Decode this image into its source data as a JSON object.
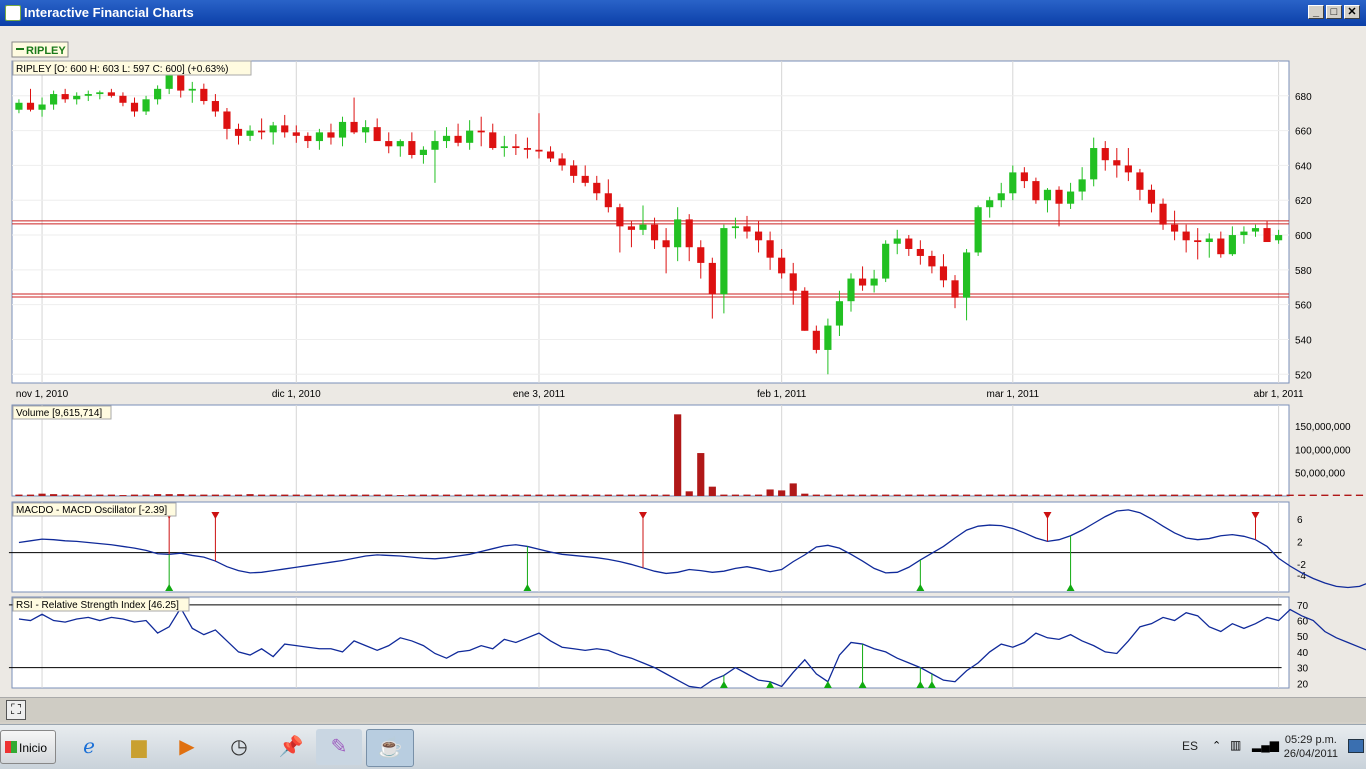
{
  "window": {
    "title": "Interactive Financial Charts",
    "min": "_",
    "max": "□",
    "close": "✕"
  },
  "legend": {
    "symbol": "RIPLEY"
  },
  "price_panel": {
    "label": "RIPLEY [O: 600  H: 603  L: 597  C: 600] (+0.63%)"
  },
  "volume_panel": {
    "label": "Volume [9,615,714]"
  },
  "macd_panel": {
    "label": "MACDO - MACD Oscillator [-2.39]"
  },
  "rsi_panel": {
    "label": "RSI - Relative Strength Index [46.25]"
  },
  "colors": {
    "up": "#22c022",
    "down": "#dd1111",
    "line": "#102a9a",
    "hline": "#cc2222",
    "grid": "#d6d6d6"
  },
  "taskbar": {
    "start": "Inicio",
    "lang": "ES",
    "time": "05:29 p.m.",
    "date": "26/04/2011"
  },
  "chart_data": [
    {
      "type": "candlestick",
      "name": "RIPLEY",
      "ylim": [
        515,
        700
      ],
      "yticks": [
        520,
        540,
        560,
        580,
        600,
        620,
        640,
        660,
        680
      ],
      "xlabels": [
        "nov 1, 2010",
        "dic 1, 2010",
        "ene 3, 2011",
        "feb 1, 2011",
        "mar 1, 2011",
        "abr 1, 2011"
      ],
      "xlabel_index": [
        2,
        24,
        45,
        66,
        86,
        109
      ],
      "hlines": [
        607,
        565
      ],
      "candles": [
        [
          672,
          678,
          670,
          676
        ],
        [
          676,
          684,
          671,
          672
        ],
        [
          672,
          679,
          668,
          675
        ],
        [
          675,
          683,
          672,
          681
        ],
        [
          681,
          684,
          676,
          678
        ],
        [
          678,
          682,
          675,
          680
        ],
        [
          680,
          683,
          677,
          681
        ],
        [
          681,
          683,
          678,
          682
        ],
        [
          682,
          684,
          679,
          680
        ],
        [
          680,
          682,
          674,
          676
        ],
        [
          676,
          679,
          668,
          671
        ],
        [
          671,
          680,
          669,
          678
        ],
        [
          678,
          686,
          675,
          684
        ],
        [
          684,
          700,
          681,
          697
        ],
        [
          697,
          699,
          679,
          683
        ],
        [
          683,
          688,
          676,
          684
        ],
        [
          684,
          687,
          675,
          677
        ],
        [
          677,
          681,
          668,
          671
        ],
        [
          671,
          673,
          655,
          661
        ],
        [
          661,
          664,
          652,
          657
        ],
        [
          657,
          663,
          654,
          660
        ],
        [
          660,
          667,
          655,
          659
        ],
        [
          659,
          665,
          652,
          663
        ],
        [
          663,
          669,
          656,
          659
        ],
        [
          659,
          663,
          653,
          657
        ],
        [
          657,
          659,
          650,
          654
        ],
        [
          654,
          661,
          649,
          659
        ],
        [
          659,
          664,
          652,
          656
        ],
        [
          656,
          668,
          651,
          665
        ],
        [
          665,
          679,
          658,
          659
        ],
        [
          659,
          666,
          653,
          662
        ],
        [
          662,
          667,
          655,
          654
        ],
        [
          654,
          659,
          647,
          651
        ],
        [
          651,
          655,
          645,
          654
        ],
        [
          654,
          659,
          644,
          646
        ],
        [
          646,
          651,
          641,
          649
        ],
        [
          649,
          660,
          630,
          654
        ],
        [
          654,
          662,
          650,
          657
        ],
        [
          657,
          664,
          651,
          653
        ],
        [
          653,
          666,
          649,
          660
        ],
        [
          660,
          668,
          651,
          659
        ],
        [
          659,
          664,
          649,
          650
        ],
        [
          650,
          657,
          645,
          651
        ],
        [
          651,
          658,
          646,
          650
        ],
        [
          650,
          656,
          644,
          649
        ],
        [
          649,
          670,
          644,
          648
        ],
        [
          648,
          651,
          642,
          644
        ],
        [
          644,
          647,
          637,
          640
        ],
        [
          640,
          643,
          630,
          634
        ],
        [
          634,
          640,
          628,
          630
        ],
        [
          630,
          634,
          620,
          624
        ],
        [
          624,
          632,
          613,
          616
        ],
        [
          616,
          618,
          590,
          605
        ],
        [
          605,
          608,
          593,
          603
        ],
        [
          603,
          617,
          600,
          606
        ],
        [
          606,
          610,
          592,
          597
        ],
        [
          597,
          604,
          578,
          593
        ],
        [
          593,
          616,
          585,
          609
        ],
        [
          609,
          612,
          585,
          593
        ],
        [
          593,
          597,
          575,
          584
        ],
        [
          584,
          587,
          552,
          566
        ],
        [
          566,
          606,
          555,
          604
        ],
        [
          604,
          610,
          598,
          605
        ],
        [
          605,
          611,
          598,
          602
        ],
        [
          602,
          608,
          590,
          597
        ],
        [
          597,
          602,
          580,
          587
        ],
        [
          587,
          592,
          575,
          578
        ],
        [
          578,
          584,
          560,
          568
        ],
        [
          568,
          570,
          545,
          545
        ],
        [
          545,
          548,
          532,
          534
        ],
        [
          534,
          552,
          520,
          548
        ],
        [
          548,
          568,
          542,
          562
        ],
        [
          562,
          578,
          556,
          575
        ],
        [
          575,
          582,
          568,
          571
        ],
        [
          571,
          580,
          567,
          575
        ],
        [
          575,
          597,
          573,
          595
        ],
        [
          595,
          603,
          589,
          598
        ],
        [
          598,
          600,
          588,
          592
        ],
        [
          592,
          597,
          583,
          588
        ],
        [
          588,
          591,
          578,
          582
        ],
        [
          582,
          589,
          570,
          574
        ],
        [
          574,
          577,
          558,
          564
        ],
        [
          564,
          592,
          551,
          590
        ],
        [
          590,
          617,
          588,
          616
        ],
        [
          616,
          622,
          610,
          620
        ],
        [
          620,
          630,
          616,
          624
        ],
        [
          624,
          640,
          620,
          636
        ],
        [
          636,
          639,
          627,
          631
        ],
        [
          631,
          633,
          618,
          620
        ],
        [
          620,
          627,
          613,
          626
        ],
        [
          626,
          628,
          605,
          618
        ],
        [
          618,
          630,
          615,
          625
        ],
        [
          625,
          639,
          620,
          632
        ],
        [
          632,
          656,
          628,
          650
        ],
        [
          650,
          654,
          637,
          643
        ],
        [
          643,
          650,
          633,
          640
        ],
        [
          640,
          650,
          631,
          636
        ],
        [
          636,
          638,
          620,
          626
        ],
        [
          626,
          629,
          613,
          618
        ],
        [
          618,
          621,
          603,
          606
        ],
        [
          606,
          614,
          597,
          602
        ],
        [
          602,
          606,
          590,
          597
        ],
        [
          597,
          604,
          586,
          596
        ],
        [
          596,
          601,
          587,
          598
        ],
        [
          598,
          602,
          587,
          589
        ],
        [
          589,
          605,
          588,
          600
        ],
        [
          600,
          605,
          595,
          602
        ],
        [
          602,
          606,
          599,
          604
        ],
        [
          604,
          608,
          596,
          596
        ],
        [
          597,
          603,
          595,
          600
        ]
      ]
    },
    {
      "type": "bar",
      "name": "Volume",
      "ylim": [
        0,
        195000000
      ],
      "yticks": [
        50000000,
        100000000,
        150000000
      ],
      "ytick_labels": [
        "50,000,000",
        "100,000,000",
        "150,000,000"
      ],
      "values": [
        3,
        3,
        5,
        4,
        3,
        3,
        3,
        3,
        3,
        2,
        3,
        3,
        4,
        4,
        4,
        3,
        3,
        3,
        3,
        3,
        4,
        3,
        3,
        3,
        3,
        3,
        3,
        3,
        3,
        3,
        3,
        3,
        3,
        2,
        3,
        3,
        3,
        3,
        3,
        3,
        3,
        3,
        3,
        3,
        3,
        3,
        3,
        3,
        3,
        3,
        3,
        3,
        3,
        3,
        3,
        3,
        3,
        175,
        10,
        92,
        20,
        3,
        3,
        3,
        3,
        14,
        12,
        27,
        5,
        3,
        3,
        3,
        3,
        3,
        3,
        3,
        3,
        3,
        3,
        3,
        3,
        3,
        3,
        3,
        3,
        3,
        3,
        3,
        3,
        3,
        3,
        3,
        3,
        3,
        3,
        3,
        3,
        3,
        3,
        3,
        3,
        3,
        3,
        3,
        3,
        3,
        3,
        3,
        3,
        3,
        3,
        3,
        3,
        3,
        3,
        3,
        3,
        3,
        3,
        3
      ],
      "unit_scale": 1000000
    },
    {
      "type": "line",
      "name": "MACD Oscillator",
      "ylim": [
        -7,
        9
      ],
      "yticks": [
        -4,
        -2,
        2,
        6
      ],
      "zero_line": 0,
      "values": [
        1.8,
        2.1,
        2.4,
        2.3,
        2.1,
        2.0,
        1.8,
        1.6,
        1.4,
        1.1,
        0.8,
        0.4,
        -0.2,
        -0.3,
        -0.1,
        -0.5,
        -0.8,
        -1.5,
        -2.5,
        -3.2,
        -3.6,
        -3.5,
        -3.2,
        -2.9,
        -2.6,
        -2.3,
        -2.0,
        -1.7,
        -1.4,
        -1.0,
        -0.6,
        -0.4,
        -0.5,
        -0.6,
        -0.8,
        -1.0,
        -1.1,
        -0.9,
        -0.6,
        -0.3,
        0.2,
        0.7,
        1.2,
        1.4,
        1.1,
        0.6,
        0.1,
        -0.3,
        -0.5,
        -0.7,
        -0.9,
        -1.2,
        -1.6,
        -2.1,
        -2.7,
        -3.3,
        -3.7,
        -3.5,
        -3.0,
        -3.2,
        -3.5,
        -3.3,
        -2.8,
        -2.5,
        -2.9,
        -3.4,
        -3.0,
        -1.6,
        -0.4,
        1.0,
        1.3,
        0.8,
        -0.3,
        -1.5,
        -2.8,
        -3.6,
        -3.5,
        -2.6,
        -1.3,
        -0.1,
        1.1,
        2.6,
        4.0,
        4.7,
        4.9,
        4.8,
        4.3,
        3.5,
        2.6,
        2.0,
        2.3,
        3.0,
        4.0,
        5.2,
        6.4,
        7.4,
        7.6,
        7.1,
        6.0,
        4.7,
        3.5,
        2.6,
        2.3,
        2.5,
        3.0,
        3.2,
        2.9,
        2.3,
        1.1,
        -1.0,
        -2.4,
        -3.6,
        -4.6,
        -5.4,
        -6.0,
        -6.2,
        -6.0,
        -5.2,
        -4.4,
        -3.7,
        -3.2,
        -2.9
      ],
      "sell_signals": [
        13,
        17,
        54,
        89,
        107
      ],
      "buy_signals": [
        13,
        44,
        78,
        91
      ]
    },
    {
      "type": "line",
      "name": "RSI",
      "ylim": [
        17,
        75
      ],
      "yticks": [
        20,
        30,
        40,
        50,
        60,
        70
      ],
      "hlines": [
        70,
        30
      ],
      "values": [
        61,
        60,
        64,
        60,
        59,
        61,
        62,
        60,
        62,
        61,
        59,
        60,
        52,
        56,
        68,
        55,
        51,
        54,
        47,
        40,
        38,
        42,
        37,
        45,
        44,
        43,
        42,
        42,
        40,
        47,
        44,
        41,
        44,
        49,
        47,
        44,
        39,
        36,
        40,
        41,
        44,
        42,
        48,
        46,
        49,
        52,
        47,
        43,
        42,
        41,
        42,
        41,
        38,
        36,
        33,
        30,
        26,
        22,
        18,
        17,
        22,
        25,
        30,
        26,
        22,
        21,
        18,
        27,
        35,
        26,
        21,
        38,
        46,
        45,
        42,
        40,
        36,
        33,
        30,
        26,
        22,
        21,
        28,
        33,
        40,
        45,
        43,
        46,
        52,
        49,
        48,
        51,
        47,
        44,
        40,
        39,
        47,
        56,
        58,
        62,
        60,
        65,
        63,
        56,
        53,
        58,
        55,
        58,
        62,
        60,
        67,
        63,
        60,
        53,
        49,
        46,
        43,
        40,
        39,
        38,
        41,
        47,
        48,
        45,
        43,
        45
      ]
    }
  ]
}
